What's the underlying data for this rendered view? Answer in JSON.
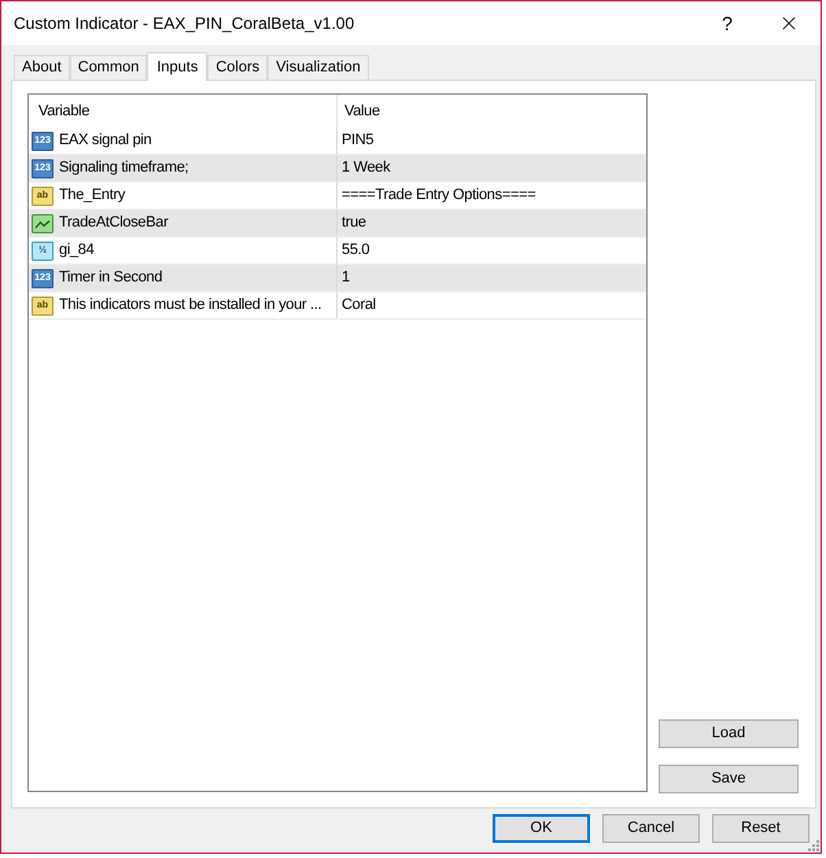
{
  "window": {
    "title": "Custom Indicator - EAX_PIN_CoralBeta_v1.00",
    "help_glyph": "?"
  },
  "tabs": [
    {
      "label": "About",
      "selected": false
    },
    {
      "label": "Common",
      "selected": false
    },
    {
      "label": "Inputs",
      "selected": true
    },
    {
      "label": "Colors",
      "selected": false
    },
    {
      "label": "Visualization",
      "selected": false
    }
  ],
  "table": {
    "columns": [
      "Variable",
      "Value"
    ],
    "rows": [
      {
        "kind": "int",
        "badge": "123",
        "variable": "EAX signal pin",
        "value": "PIN5"
      },
      {
        "kind": "int",
        "badge": "123",
        "variable": "Signaling timeframe;",
        "value": "1 Week"
      },
      {
        "kind": "string",
        "badge": "ab",
        "variable": "The_Entry",
        "value": "====Trade Entry Options===="
      },
      {
        "kind": "bool",
        "variable": "TradeAtCloseBar",
        "value": "true"
      },
      {
        "kind": "double",
        "badge": "½",
        "variable": "gi_84",
        "value": "55.0"
      },
      {
        "kind": "int",
        "badge": "123",
        "variable": "Timer in Second",
        "value": "1"
      },
      {
        "kind": "string",
        "badge": "ab",
        "variable": "This indicators must be installed in your ...",
        "value": "Coral"
      }
    ]
  },
  "side_buttons": [
    "Load",
    "Save"
  ],
  "buttons": [
    {
      "label": "OK",
      "default": true
    },
    {
      "label": "Cancel",
      "default": false
    },
    {
      "label": "Reset",
      "default": false
    }
  ]
}
